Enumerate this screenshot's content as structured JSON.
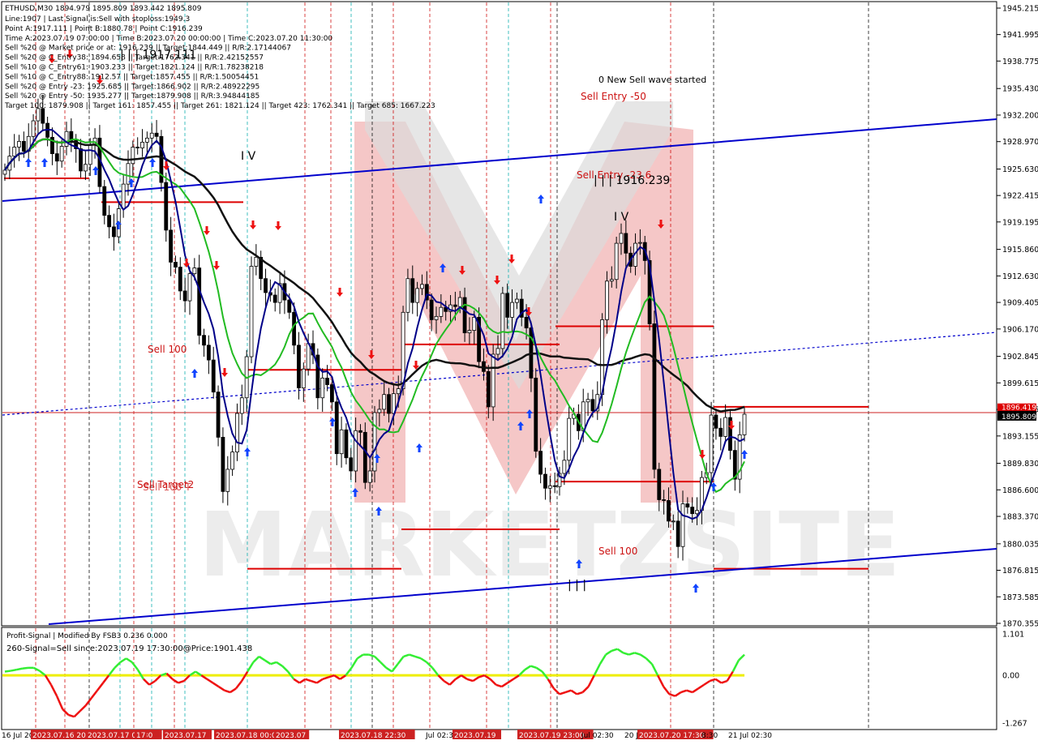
{
  "chart_data": [
    {
      "type": "candlestick",
      "symbol_header": "ETHUSD,M30  1894.979 1895.809 1893.442 1895.809",
      "info_lines": [
        "Line:1907 | Last Signal is:Sell with stoploss:1949.3",
        "Point A:1917.111 | Point B:1880.78 | Point C:1916.239",
        "Time A:2023.07.19 07:00:00 | Time B:2023.07.20 00:00:00 | Time C:2023.07.20 11:30:00",
        "Sell %20 @ Market price or at: 1916.239 || Target:1844.449 || R/R:2.17144067",
        "Sell %20 @ C_Entry38: 1894.658 || Target:1762.341 || R/R:2.42152557",
        "Sell %10 @ C_Entry61: 1903.233 || Target:1821.124 || R/R:1.78238218",
        "Sell %10 @ C_Entry88: 1912.57 || Target:1857.455 || R/R:1.50054451",
        "Sell %20 @ Entry -23: 1925.685 || Target:1866.902 || R/R:2.48922295",
        "Sell %20 @ Entry -50: 1935.277 || Target:1879.908 || R/R:3.94844185",
        "Target 100: 1879.908 || Target 161: 1857.455 || Target 261: 1821.124 || Target 423: 1762.341 || Target 685: 1667.223"
      ],
      "y_ticks": [
        "1945.215",
        "1941.995",
        "1938.775",
        "1935.430",
        "1932.200",
        "1928.970",
        "1925.630",
        "1922.415",
        "1919.195",
        "1915.860",
        "1912.630",
        "1909.405",
        "1906.170",
        "1902.845",
        "1899.615",
        "1896.385",
        "1893.155",
        "1889.830",
        "1886.600",
        "1883.370",
        "1880.035",
        "1876.815",
        "1873.585",
        "1870.355"
      ],
      "ylim": [
        1870.355,
        1945.215
      ],
      "current_price": "1895.809",
      "previous_price_tag": "1896.419",
      "annotations": {
        "new_wave": "0 New Sell wave started",
        "entry_50": "Sell Entry -50",
        "entry_23": "Sell Entry -23.6",
        "point_c": "| | | 1916.239",
        "point_a": "| | | 1917.111",
        "wave_iv_1": "I V",
        "wave_iv_2": "I V",
        "sell_100_left": "Sell 100",
        "sell_target2": "Sell Target2",
        "sell_100_target": "Sell 100 T",
        "sell_100_right": "Sell 100",
        "point_b": "| | |"
      },
      "series_colors": {
        "candles": "#000000",
        "ma_slow": "#111111",
        "ma_mid": "#22bb22",
        "ma_fast": "#000088",
        "channel": "#0000cc",
        "levels": "#dd0000"
      },
      "approx_closes": [
        1925.5,
        1927.2,
        1928.3,
        1929.0,
        1927.8,
        1929.6,
        1931.5,
        1933.0,
        1931.2,
        1929.5,
        1927.5,
        1926.6,
        1928.4,
        1930.2,
        1929.1,
        1928.1,
        1925.4,
        1926.2,
        1928.6,
        1929.4,
        1923.5,
        1920.0,
        1918.6,
        1917.4,
        1920.8,
        1923.8,
        1926.3,
        1928.3,
        1928.2,
        1928.9,
        1929.4,
        1930.0,
        1929.6,
        1924.0,
        1918.2,
        1914.3,
        1913.7,
        1910.8,
        1909.6,
        1912.9,
        1913.6,
        1905.4,
        1904.2,
        1902.4,
        1898.5,
        1893.0,
        1886.4,
        1889.1,
        1891.2,
        1895.9,
        1897.8,
        1902.8,
        1913.8,
        1914.9,
        1912.3,
        1910.6,
        1910.3,
        1909.4,
        1911.7,
        1909.7,
        1908.2,
        1904.2,
        1899.0,
        1901.3,
        1904.4,
        1903.0,
        1897.8,
        1900.2,
        1899.4,
        1897.3,
        1891.0,
        1893.9,
        1890.5,
        1888.9,
        1893.8,
        1893.6,
        1887.5,
        1888.9,
        1896.0,
        1896.4,
        1898.2,
        1895.9,
        1898.3,
        1898.9,
        1908.2,
        1912.3,
        1909.4,
        1911.1,
        1911.6,
        1909.7,
        1907.3,
        1907.7,
        1908.8,
        1908.3,
        1909.1,
        1908.9,
        1910.0,
        1905.7,
        1906.0,
        1907.6,
        1902.2,
        1901.0,
        1896.7,
        1903.1,
        1903.8,
        1910.5,
        1907.6,
        1909.4,
        1909.8,
        1907.6,
        1906.3,
        1900.2,
        1891.3,
        1888.5,
        1886.8,
        1887.1,
        1887.0,
        1888.6,
        1890.2,
        1895.3,
        1895.8,
        1893.8,
        1897.3,
        1897.6,
        1896.2,
        1898.2,
        1907.3,
        1912.0,
        1912.2,
        1916.6,
        1917.8,
        1915.4,
        1913.8,
        1916.6,
        1916.7,
        1914.5,
        1906.8,
        1889.1,
        1885.4,
        1885.3,
        1882.8,
        1882.8,
        1879.7,
        1884.9,
        1884.5,
        1883.7,
        1884.1,
        1888.1,
        1888.7,
        1895.7,
        1894.1,
        1893.1,
        1895.4,
        1891.4,
        1887.9,
        1893.3,
        1895.8
      ],
      "red_levels": [
        1924.5,
        1921.6,
        1901.2,
        1877.0,
        1904.3,
        1906.5,
        1881.8,
        1887.6,
        1896.7,
        1877.0
      ],
      "osc_y_ticks": [
        "1.101",
        "0.00",
        "-1.267"
      ],
      "osc_ylim": [
        -1.267,
        1.101
      ],
      "osc_zero": 0.0,
      "osc_line1": "Profit-Signal | Modified By FSB3 0.236 0.000",
      "osc_line2": "260-Signal=Sell since:2023.07.19 17:30:00@Price:1901.438",
      "osc_values": [
        0.1,
        0.12,
        0.15,
        0.18,
        0.2,
        0.2,
        0.12,
        0.0,
        -0.25,
        -0.55,
        -0.9,
        -1.05,
        -1.1,
        -0.95,
        -0.8,
        -0.6,
        -0.4,
        -0.2,
        0.0,
        0.2,
        0.35,
        0.45,
        0.35,
        0.15,
        -0.1,
        -0.25,
        -0.15,
        0.0,
        0.05,
        -0.1,
        -0.2,
        -0.15,
        0.0,
        0.1,
        0.0,
        -0.1,
        -0.2,
        -0.3,
        -0.4,
        -0.45,
        -0.35,
        -0.15,
        0.1,
        0.35,
        0.5,
        0.4,
        0.3,
        0.35,
        0.25,
        0.1,
        -0.1,
        -0.2,
        -0.1,
        -0.15,
        -0.2,
        -0.1,
        -0.05,
        0.0,
        -0.1,
        0.0,
        0.2,
        0.45,
        0.55,
        0.55,
        0.5,
        0.35,
        0.2,
        0.1,
        0.3,
        0.5,
        0.55,
        0.5,
        0.45,
        0.35,
        0.2,
        0.0,
        -0.15,
        -0.25,
        -0.1,
        0.0,
        -0.1,
        -0.15,
        -0.05,
        0.0,
        -0.1,
        -0.25,
        -0.3,
        -0.2,
        -0.1,
        0.0,
        0.15,
        0.25,
        0.2,
        0.1,
        -0.1,
        -0.35,
        -0.5,
        -0.45,
        -0.4,
        -0.5,
        -0.45,
        -0.3,
        0.0,
        0.3,
        0.55,
        0.65,
        0.7,
        0.6,
        0.55,
        0.6,
        0.55,
        0.45,
        0.3,
        0.0,
        -0.3,
        -0.5,
        -0.55,
        -0.45,
        -0.4,
        -0.45,
        -0.35,
        -0.25,
        -0.15,
        -0.1,
        -0.2,
        -0.15,
        0.1,
        0.4,
        0.55
      ],
      "x_labels": [
        "16 Jul 20",
        "2023.07.16 20:00",
        "2023.07.17 03:30",
        "17",
        "2023.07.17",
        "2023.07.18 00:00",
        "2023.07",
        "2023.07.18 22:30",
        "Jul 02:3",
        "2023.07.19",
        "2023.07.19 23:00",
        "Jul 02:30",
        "20 J",
        "2023.07.20 17:30",
        "8:30",
        "21 Jul 02:30"
      ]
    }
  ]
}
